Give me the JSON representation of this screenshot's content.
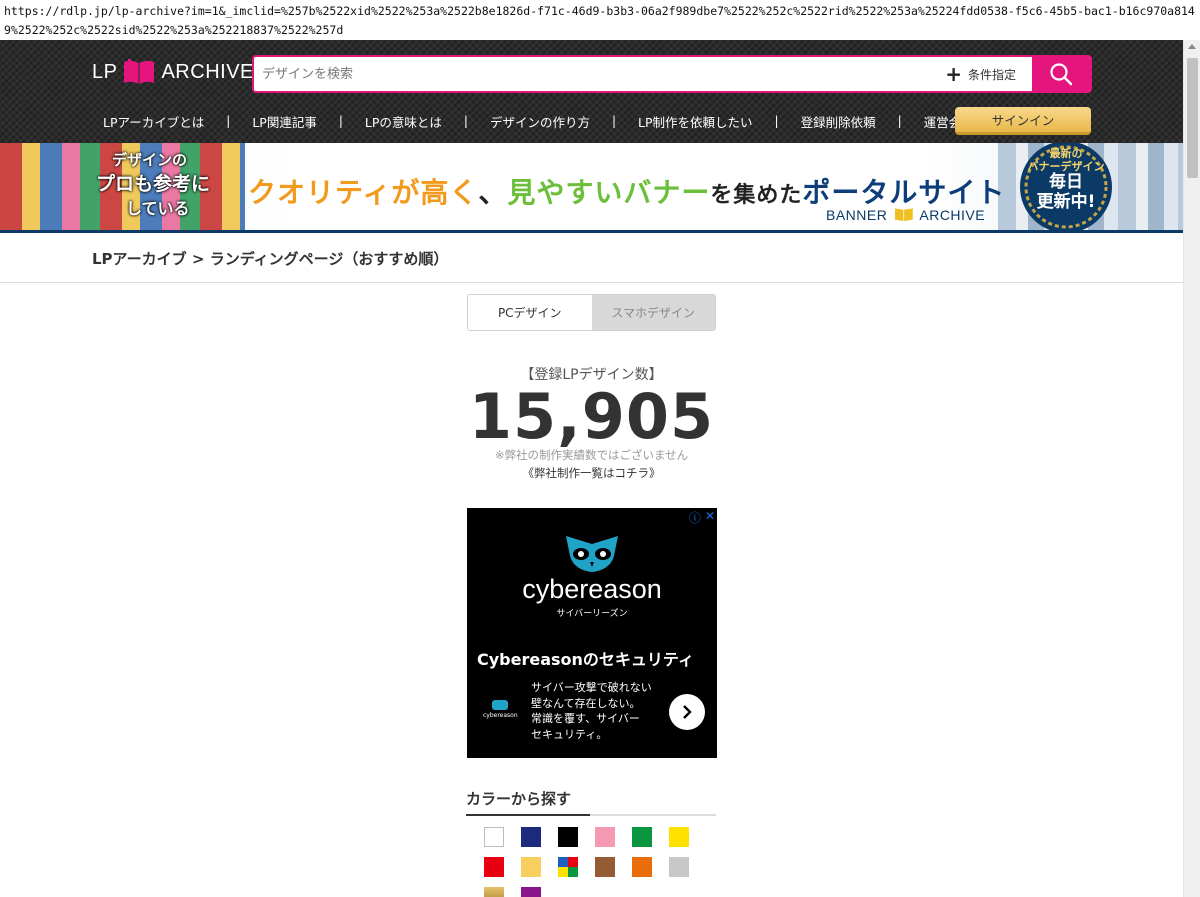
{
  "browser": {
    "url": "https://rdlp.jp/lp-archive?im=1&_imclid=%257b%2522xid%2522%253a%2522b8e1826d-f71c-46d9-b3b3-06a2f989dbe7%2522%252c%2522rid%2522%253a%25224fdd0538-f5c6-45b5-bac1-b16c970a8149%2522%252c%2522sid%2522%253a%252218837%2522%257d"
  },
  "header": {
    "logo_left": "LP",
    "logo_right": "ARCHIVE",
    "search_placeholder": "デザインを検索",
    "search_value": "",
    "condition_label": "条件指定",
    "nav": [
      "LPアーカイブとは",
      "LP関連記事",
      "LPの意味とは",
      "デザインの作り方",
      "LP制作を依頼したい",
      "登録削除依頼",
      "運営会社"
    ],
    "separator": "|",
    "signin_label": "サインイン",
    "accent_color": "#e4157d"
  },
  "banner": {
    "bubble_line1": "デザインの",
    "bubble_line2": "プロも参考に",
    "bubble_line3": "している",
    "headline_part1": "クオリティが高く",
    "headline_part2": "、",
    "headline_part3": "見やすいバナー",
    "headline_part4": "を集めた",
    "headline_part5": "ポータルサイト",
    "logo_text_left": "BANNER",
    "logo_text_right": "ARCHIVE",
    "badge_line1": "最新の",
    "badge_line2": "バナーデザイン",
    "badge_line3": "毎日",
    "badge_line4": "更新中!"
  },
  "breadcrumb": {
    "root": "LPアーカイブ",
    "arrow": ">",
    "current": "ランディングページ（おすすめ順）"
  },
  "tabs": {
    "pc": "PCデザイン",
    "sp": "スマホデザイン",
    "active": "pc"
  },
  "stats": {
    "label": "【登録LPデザイン数】",
    "count": "15,905",
    "note": "※弊社の制作実績数ではございません",
    "link": "《弊社制作一覧はコチラ》"
  },
  "ad": {
    "brand": "cybereason",
    "brand_sub": "サイバーリーズン",
    "headline": "Cybereasonのセキュリティ",
    "mini_brand": "cybereason",
    "body_line1": "サイバー攻撃で破れない",
    "body_line2": "壁なんて存在しない。",
    "body_line3": "常識を覆す、サイバー",
    "body_line4": "セキュリティ。",
    "info_glyph": "ⓘ",
    "close_glyph": "✕"
  },
  "color_search": {
    "title": "カラーから探す",
    "swatches": [
      {
        "name": "white",
        "color": "#ffffff"
      },
      {
        "name": "navy",
        "color": "#1b2a7d"
      },
      {
        "name": "black",
        "color": "#000000"
      },
      {
        "name": "pink",
        "color": "#f59ab2"
      },
      {
        "name": "green",
        "color": "#0a9640"
      },
      {
        "name": "yellow",
        "color": "#ffe100"
      },
      {
        "name": "red",
        "color": "#e60012"
      },
      {
        "name": "beige",
        "color": "#f7cf60"
      },
      {
        "name": "multi",
        "color": "multi"
      },
      {
        "name": "brown",
        "color": "#955b34"
      },
      {
        "name": "orange",
        "color": "#e96d0b"
      },
      {
        "name": "gray",
        "color": "#c8c8c8"
      },
      {
        "name": "gold",
        "color": "gold"
      },
      {
        "name": "purple",
        "color": "#8a148c"
      }
    ]
  }
}
